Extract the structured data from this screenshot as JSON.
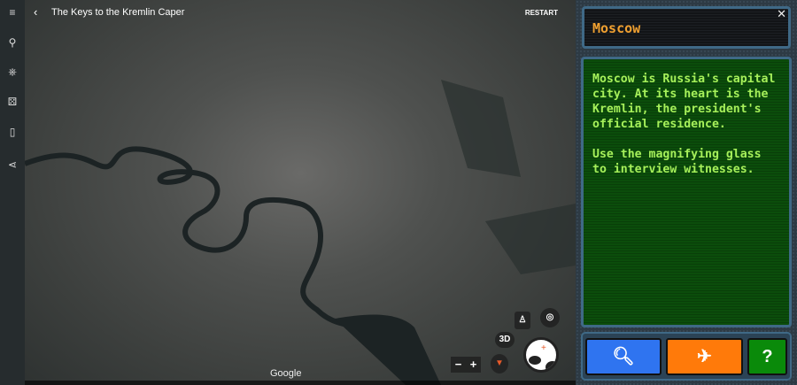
{
  "header": {
    "title": "The Keys to the Kremlin Caper",
    "restart_label": "RESTART"
  },
  "sidebar": {
    "items": [
      {
        "icon": "menu-icon",
        "glyph": "≡"
      },
      {
        "icon": "search-icon",
        "glyph": "⚲"
      },
      {
        "icon": "voyager-icon",
        "glyph": "⎈"
      },
      {
        "icon": "random-icon",
        "glyph": "⚄"
      },
      {
        "icon": "bookmark-icon",
        "glyph": "▯"
      },
      {
        "icon": "share-icon",
        "glyph": "⋖"
      }
    ]
  },
  "map": {
    "google_label": "Google",
    "ctrl_3d": "3D",
    "zoom_out": "−",
    "zoom_in": "+"
  },
  "panel": {
    "city": "Moscow",
    "close": "✕",
    "paragraphs": [
      "Moscow is Russia's capital city. At its heart is the Kremlin, the president's official residence.",
      "Use the magnifying glass to interview witnesses."
    ],
    "buttons": {
      "help": "?"
    },
    "colors": {
      "investigate": "#2f74f0",
      "travel": "#ff7a0a",
      "help": "#0a8a0a"
    }
  }
}
